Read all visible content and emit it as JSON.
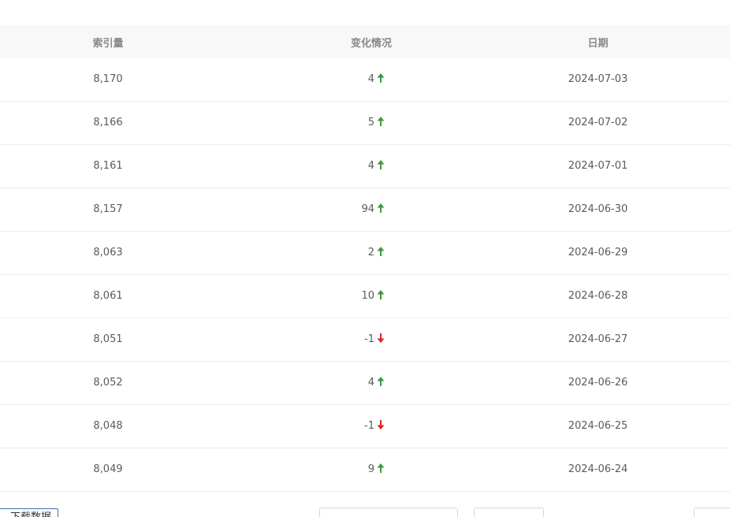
{
  "table": {
    "headers": {
      "index": "索引量",
      "change": "变化情况",
      "date": "日期"
    },
    "rows": [
      {
        "index": "8,170",
        "change": "4",
        "trend": "up",
        "date": "2024-07-03"
      },
      {
        "index": "8,166",
        "change": "5",
        "trend": "up",
        "date": "2024-07-02"
      },
      {
        "index": "8,161",
        "change": "4",
        "trend": "up",
        "date": "2024-07-01"
      },
      {
        "index": "8,157",
        "change": "94",
        "trend": "up",
        "date": "2024-06-30"
      },
      {
        "index": "8,063",
        "change": "2",
        "trend": "up",
        "date": "2024-06-29"
      },
      {
        "index": "8,061",
        "change": "10",
        "trend": "up",
        "date": "2024-06-28"
      },
      {
        "index": "8,051",
        "change": "-1",
        "trend": "down",
        "date": "2024-06-27"
      },
      {
        "index": "8,052",
        "change": "4",
        "trend": "up",
        "date": "2024-06-26"
      },
      {
        "index": "8,048",
        "change": "-1",
        "trend": "down",
        "date": "2024-06-25"
      },
      {
        "index": "8,049",
        "change": "9",
        "trend": "up",
        "date": "2024-06-24"
      }
    ]
  },
  "footer": {
    "download_label": "下载数据"
  },
  "colors": {
    "up": "#3b9a3b",
    "down": "#e02020"
  },
  "icons": {
    "up": "arrow-up-icon",
    "down": "arrow-down-icon"
  }
}
